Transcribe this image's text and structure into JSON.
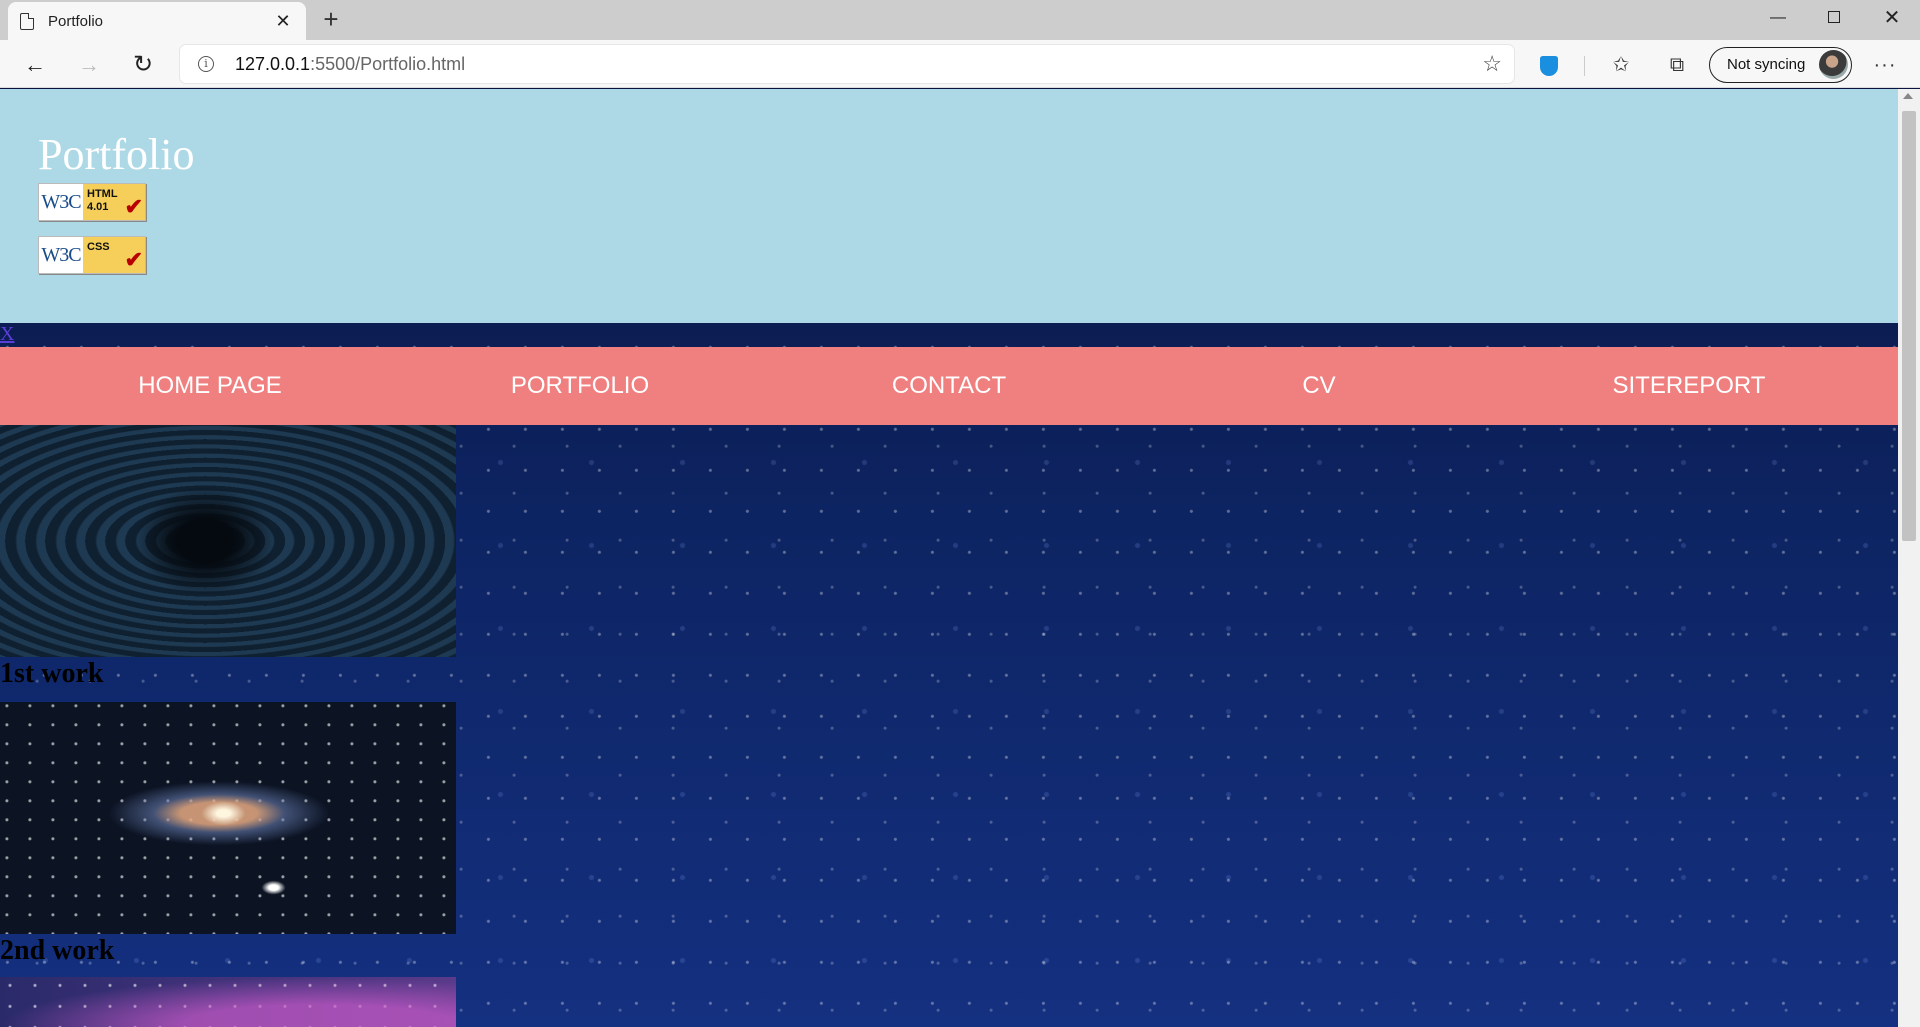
{
  "browser": {
    "tab_title": "Portfolio",
    "url_host": "127.0.0.1",
    "url_rest": ":5500/Portfolio.html",
    "sync_label": "Not syncing"
  },
  "page": {
    "title": "Portfolio",
    "badges": [
      {
        "w3c": "W3C",
        "label_line1": "HTML",
        "label_line2": "4.01"
      },
      {
        "w3c": "W3C",
        "label_line1": "CSS",
        "label_line2": ""
      }
    ],
    "close_link": "X",
    "nav": [
      {
        "label": "HOME PAGE"
      },
      {
        "label": "PORTFOLIO"
      },
      {
        "label": "CONTACT"
      },
      {
        "label": "CV"
      },
      {
        "label": "SITEREPORT"
      }
    ],
    "works": [
      {
        "caption": "1st work"
      },
      {
        "caption": "2nd work"
      }
    ]
  },
  "colors": {
    "header_bg": "#add8e6",
    "nav_bg": "#f08080",
    "page_bg": "#0b1340"
  }
}
